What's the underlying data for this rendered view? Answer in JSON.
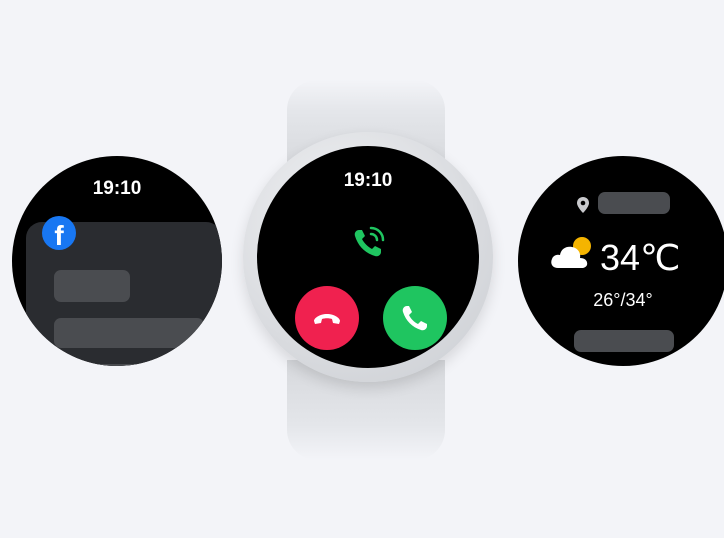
{
  "left_watch": {
    "time": "19:10",
    "app_icon": "facebook-icon",
    "app_letter": "f"
  },
  "center_watch": {
    "time": "19:10",
    "call_state_icon": "ringing-phone-icon",
    "decline_icon": "phone-decline-icon",
    "accept_icon": "phone-accept-icon"
  },
  "right_watch": {
    "location_icon": "location-pin-icon",
    "weather_icon": "partly-cloudy-icon",
    "temperature": "34℃",
    "range": "26°/34°"
  },
  "colors": {
    "background": "#f3f4f8",
    "decline": "#f0214f",
    "accept": "#1fc560",
    "facebook": "#1877f2",
    "sun": "#f5b400"
  }
}
